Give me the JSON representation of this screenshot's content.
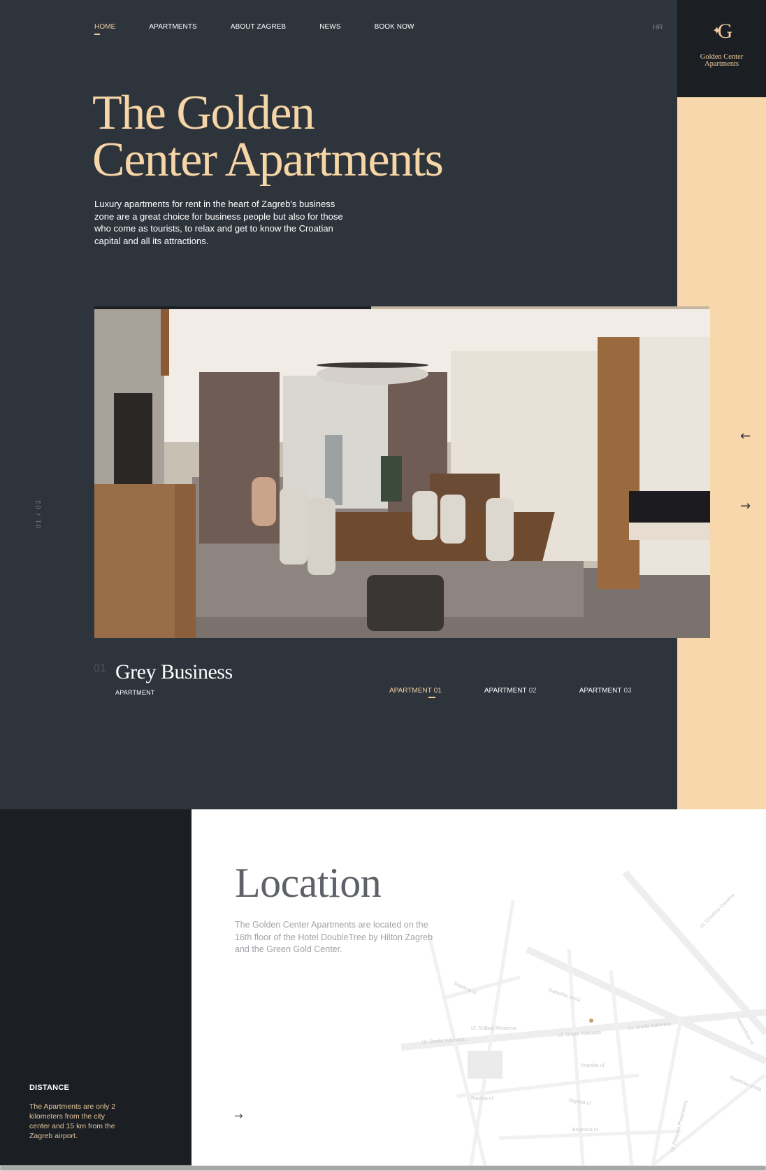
{
  "nav": {
    "items": [
      "HOME",
      "APARTMENTS",
      "ABOUT ZAGREB",
      "NEWS",
      "BOOK NOW"
    ],
    "active_index": 0,
    "language": "HR"
  },
  "logo": {
    "mark": "G",
    "line1": "Golden Center",
    "line2": "Apartments"
  },
  "hero": {
    "title_line1": "The Golden",
    "title_line2": "Center Apartments",
    "intro": "Luxury apartments for rent in the heart of Zagreb's business zone are a great choice for business people but also for those who come as tourists, to relax and get to know the Croatian capital and all its attractions."
  },
  "slider": {
    "counter_current": "01",
    "counter_separator": "/",
    "counter_total": "03",
    "progress": 0.45,
    "prev_arrow": "←",
    "next_arrow": "→"
  },
  "apartment": {
    "number": "01",
    "title": "Grey Business",
    "subtitle": "APARTMENT",
    "tabs": [
      {
        "label": "APARTMENT",
        "num": "01"
      },
      {
        "label": "APARTMENT",
        "num": "02"
      },
      {
        "label": "APARTMENT",
        "num": "03"
      }
    ],
    "active_tab": 0
  },
  "distance": {
    "title": "DISTANCE",
    "text": "The Apartments are only 2 kilometers from the city center and 15 km from the Zagreb airport."
  },
  "location": {
    "title": "Location",
    "text": "The Golden Center Apartments are located on the 16th floor of the Hotel DoubleTree by Hilton Zagreb and the Green Gold Center.",
    "arrow": "→",
    "map_labels": [
      "Ul. Grada Vukovara",
      "Ul. Grada Vukovara",
      "Ul. Grada Vukovara",
      "Radnička cesta",
      "Radnička cesta",
      "Supilova ul.",
      "Ul. Srđana Mesićeva",
      "Hvarska ul.",
      "Rapska ul.",
      "Rapska ul.",
      "Brijunska ul.",
      "Ul. Florijana Prolanovića",
      "Heinzelova ul.",
      "Ul. Charlesa Darwina"
    ]
  },
  "colors": {
    "background": "#2e343c",
    "accent": "#f6d5a6",
    "dark": "#1b1e23",
    "peach": "#f7d7ab"
  }
}
